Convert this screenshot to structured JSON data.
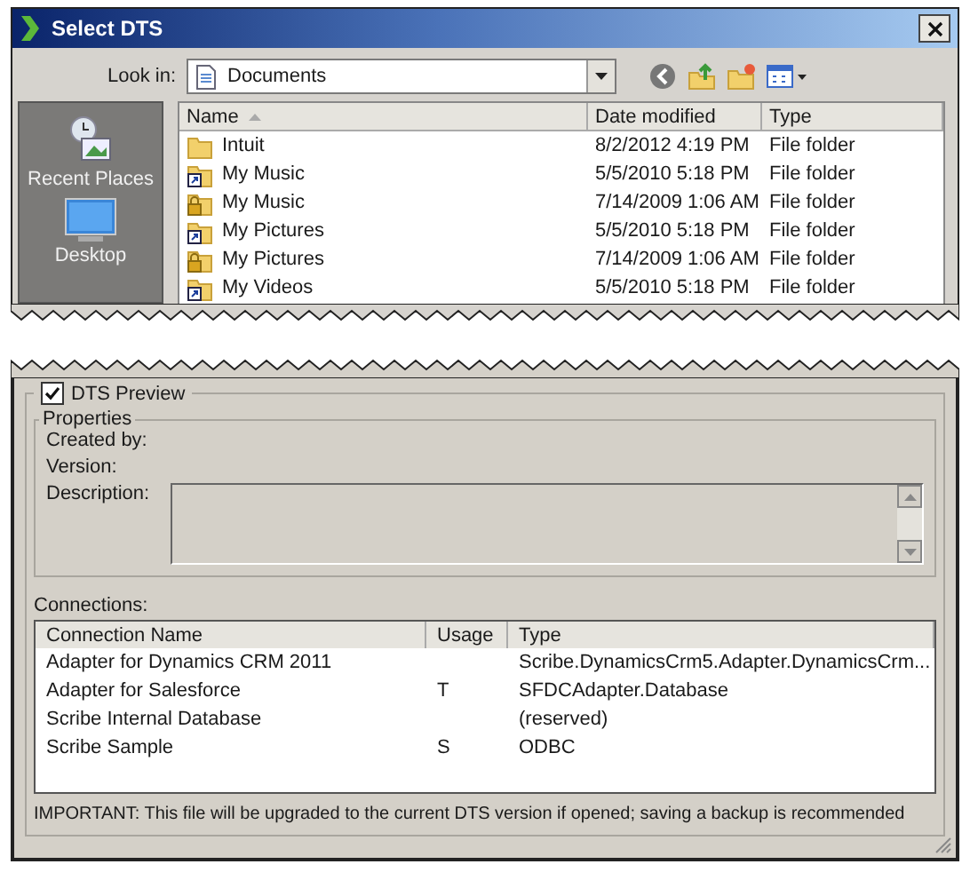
{
  "window": {
    "title": "Select DTS"
  },
  "look_in": {
    "label": "Look in:",
    "value": "Documents"
  },
  "places": [
    {
      "label": "Recent Places",
      "kind": "recent"
    },
    {
      "label": "Desktop",
      "kind": "desktop"
    }
  ],
  "files": {
    "columns": [
      {
        "label": "Name",
        "sorted": true
      },
      {
        "label": "Date modified",
        "sorted": false
      },
      {
        "label": "Type",
        "sorted": false
      }
    ],
    "rows": [
      {
        "name": "Intuit",
        "modified": "8/2/2012 4:19 PM",
        "type": "File folder",
        "kind": "folder"
      },
      {
        "name": "My Music",
        "modified": "5/5/2010 5:18 PM",
        "type": "File folder",
        "kind": "shortcut"
      },
      {
        "name": "My Music",
        "modified": "7/14/2009 1:06 AM",
        "type": "File folder",
        "kind": "locked"
      },
      {
        "name": "My Pictures",
        "modified": "5/5/2010 5:18 PM",
        "type": "File folder",
        "kind": "shortcut"
      },
      {
        "name": "My Pictures",
        "modified": "7/14/2009 1:06 AM",
        "type": "File folder",
        "kind": "locked"
      },
      {
        "name": "My Videos",
        "modified": "5/5/2010 5:18 PM",
        "type": "File folder",
        "kind": "shortcut"
      }
    ]
  },
  "preview": {
    "label": "DTS Preview",
    "checked": true
  },
  "properties": {
    "title": "Properties",
    "fields": [
      "Created by:",
      "Version:",
      "Description:"
    ]
  },
  "connections": {
    "label": "Connections:",
    "columns": [
      "Connection Name",
      "Usage",
      "Type"
    ],
    "rows": [
      {
        "name": "Adapter for Dynamics CRM 2011",
        "usage": "",
        "type": "Scribe.DynamicsCrm5.Adapter.DynamicsCrm..."
      },
      {
        "name": "Adapter for Salesforce",
        "usage": "T",
        "type": "SFDCAdapter.Database"
      },
      {
        "name": "Scribe Internal Database",
        "usage": "",
        "type": "(reserved)"
      },
      {
        "name": "Scribe Sample",
        "usage": "S",
        "type": "ODBC"
      }
    ]
  },
  "note": "IMPORTANT: This file will be upgraded to the current DTS version if opened; saving a backup is recommended"
}
